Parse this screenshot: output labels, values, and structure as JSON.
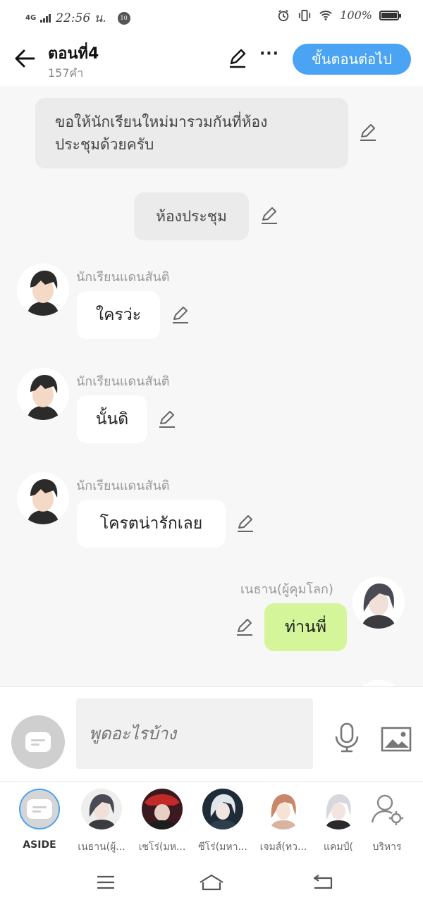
{
  "status_bar": {
    "network": "4G",
    "time": "22:56 น.",
    "notif_badge": "10",
    "battery": "100%"
  },
  "header": {
    "title": "ตอนที่4",
    "word_count": "157คำ",
    "more_label": "···",
    "next_label": "ขั้นตอนต่อไป"
  },
  "messages": {
    "narr1": {
      "line1": "ขอให้นักเรียนใหม่มารวมกันที่ห้อง",
      "line2": "ประชุมด้วยครับ"
    },
    "narr2": "ห้องประชุม",
    "m1": {
      "name": "นักเรียนแดนสันติ",
      "text": "ใครว่ะ"
    },
    "m2": {
      "name": "นักเรียนแดนสันติ",
      "text": "นั้นดิ"
    },
    "m3": {
      "name": "นักเรียนแดนสันติ",
      "text": "โครตน่ารักเลย"
    },
    "m4": {
      "name": "เนธาน(ผู้คุมโลก)",
      "text": "ท่านพี่"
    }
  },
  "input": {
    "placeholder": "พูดอะไรบ้าง"
  },
  "characters": [
    {
      "label": "ASIDE"
    },
    {
      "label": "เนธาน(ผู้..."
    },
    {
      "label": "เซโร่(มห..."
    },
    {
      "label": "ซีโร่(มหา..."
    },
    {
      "label": "เจมส์(ทว..."
    },
    {
      "label": "แคมป์("
    },
    {
      "label": "บริหาร"
    }
  ],
  "colors": {
    "accent": "#4aa3f3",
    "my_bubble": "#d4f59a"
  }
}
